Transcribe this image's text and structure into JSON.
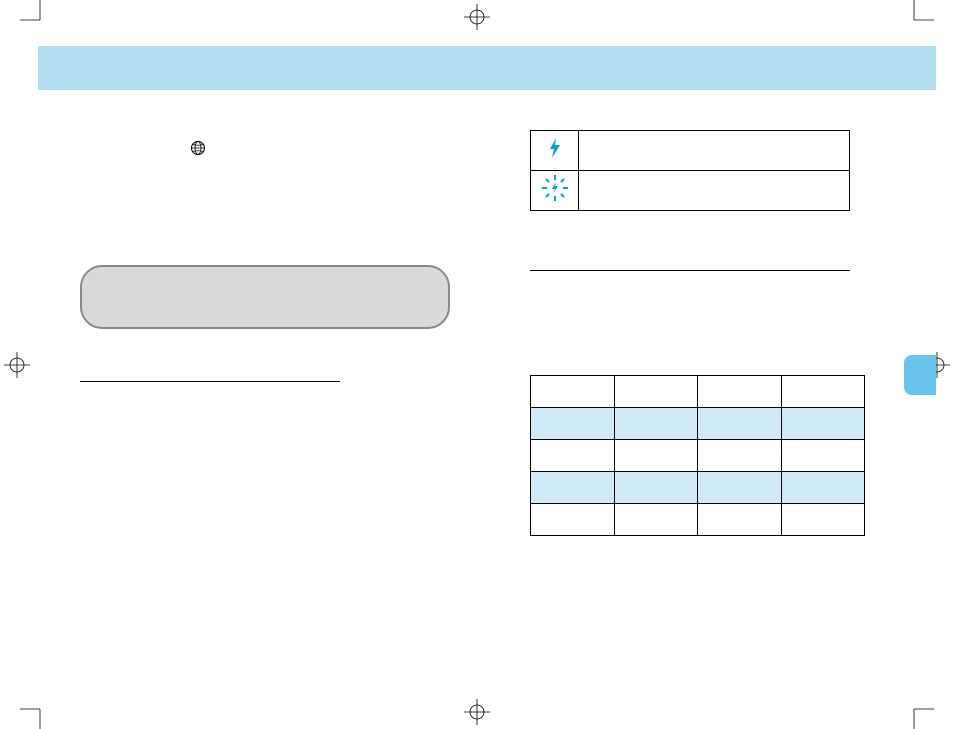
{
  "icons": {
    "globe": "globe-icon",
    "flash": "flash-icon",
    "slow_sync": "slow-sync-icon"
  },
  "flash_table": {
    "rows": [
      {
        "icon": "flash",
        "label": ""
      },
      {
        "icon": "slow_sync",
        "label": ""
      }
    ]
  },
  "range_table": {
    "headers": [
      "",
      "",
      "",
      ""
    ],
    "rows": [
      [
        "",
        "",
        "",
        ""
      ],
      [
        "",
        "",
        "",
        ""
      ],
      [
        "",
        "",
        "",
        ""
      ],
      [
        "",
        "",
        "",
        ""
      ]
    ],
    "blue_rows": [
      1,
      3
    ]
  },
  "left_column": {
    "heading": "",
    "subheading": ""
  }
}
